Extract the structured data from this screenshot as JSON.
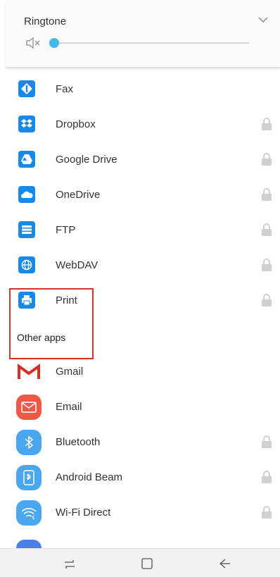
{
  "volume": {
    "title": "Ringtone",
    "level": 0.0,
    "muted": true,
    "accent_color": "#44b9e8"
  },
  "services": [
    {
      "label": "Fax",
      "icon": "fax-icon",
      "locked": false
    },
    {
      "label": "Dropbox",
      "icon": "dropbox-icon",
      "locked": true
    },
    {
      "label": "Google Drive",
      "icon": "google-drive-icon",
      "locked": true
    },
    {
      "label": "OneDrive",
      "icon": "onedrive-icon",
      "locked": true
    },
    {
      "label": "FTP",
      "icon": "ftp-icon",
      "locked": true
    },
    {
      "label": "WebDAV",
      "icon": "webdav-icon",
      "locked": true
    },
    {
      "label": "Print",
      "icon": "print-icon",
      "locked": true
    }
  ],
  "other_apps": {
    "header": "Other apps",
    "items": [
      {
        "label": "Gmail",
        "icon": "gmail-icon",
        "locked": false
      },
      {
        "label": "Email",
        "icon": "email-icon",
        "locked": false
      },
      {
        "label": "Bluetooth",
        "icon": "bluetooth-icon",
        "locked": true
      },
      {
        "label": "Android Beam",
        "icon": "android-beam-icon",
        "locked": true
      },
      {
        "label": "Wi-Fi Direct",
        "icon": "wifi-direct-icon",
        "locked": true
      }
    ]
  },
  "colors": {
    "service_icon_bg": "#1a88e6",
    "highlight_border": "#d8302c",
    "gmail_red": "#d93025",
    "email_bg": "#ee5845",
    "bluetooth_bg": "#4aa7ef"
  },
  "navbar": {
    "buttons": [
      "recents-icon",
      "home-icon",
      "back-icon"
    ]
  }
}
